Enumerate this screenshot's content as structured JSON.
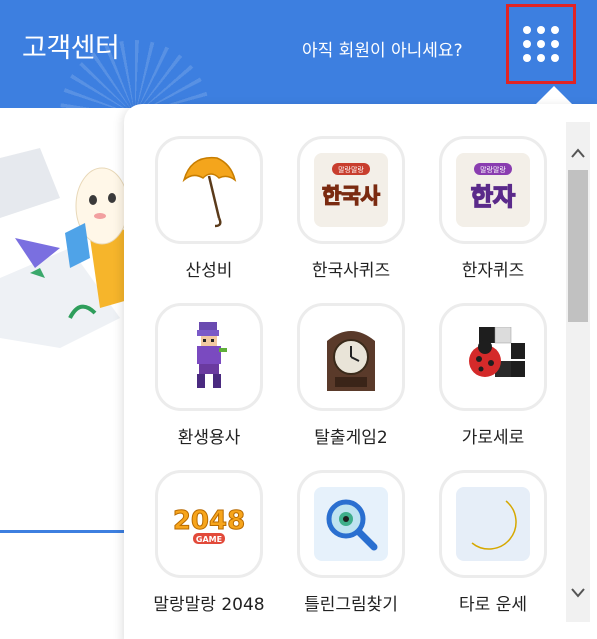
{
  "header": {
    "title": "고객센터",
    "signup_prompt": "아직 회원이 아니세요?",
    "apps_icon": "grid-icon"
  },
  "apps": [
    {
      "label": "산성비",
      "icon": "umbrella-icon"
    },
    {
      "label": "한국사퀴즈",
      "icon": "korean-history-quiz-icon",
      "logo_text": [
        "말랑말랑",
        "한국사"
      ]
    },
    {
      "label": "한자퀴즈",
      "icon": "hanja-quiz-icon",
      "logo_text": [
        "말랑말랑",
        "한자"
      ]
    },
    {
      "label": "환생용사",
      "icon": "pixel-hero-icon"
    },
    {
      "label": "탈출게임2",
      "icon": "clock-icon"
    },
    {
      "label": "가로세로",
      "icon": "ladybug-puzzle-icon"
    },
    {
      "label": "말랑말랑 2048",
      "icon": "2048-logo-icon",
      "logo_text": [
        "2048",
        "GAME"
      ]
    },
    {
      "label": "틀린그림찾기",
      "icon": "magnifier-icon"
    },
    {
      "label": "타로 운세",
      "icon": "moon-icon"
    }
  ],
  "colors": {
    "header_bg": "#3d7fe0",
    "highlight_border": "#e02424",
    "tile_border": "#ececec"
  }
}
